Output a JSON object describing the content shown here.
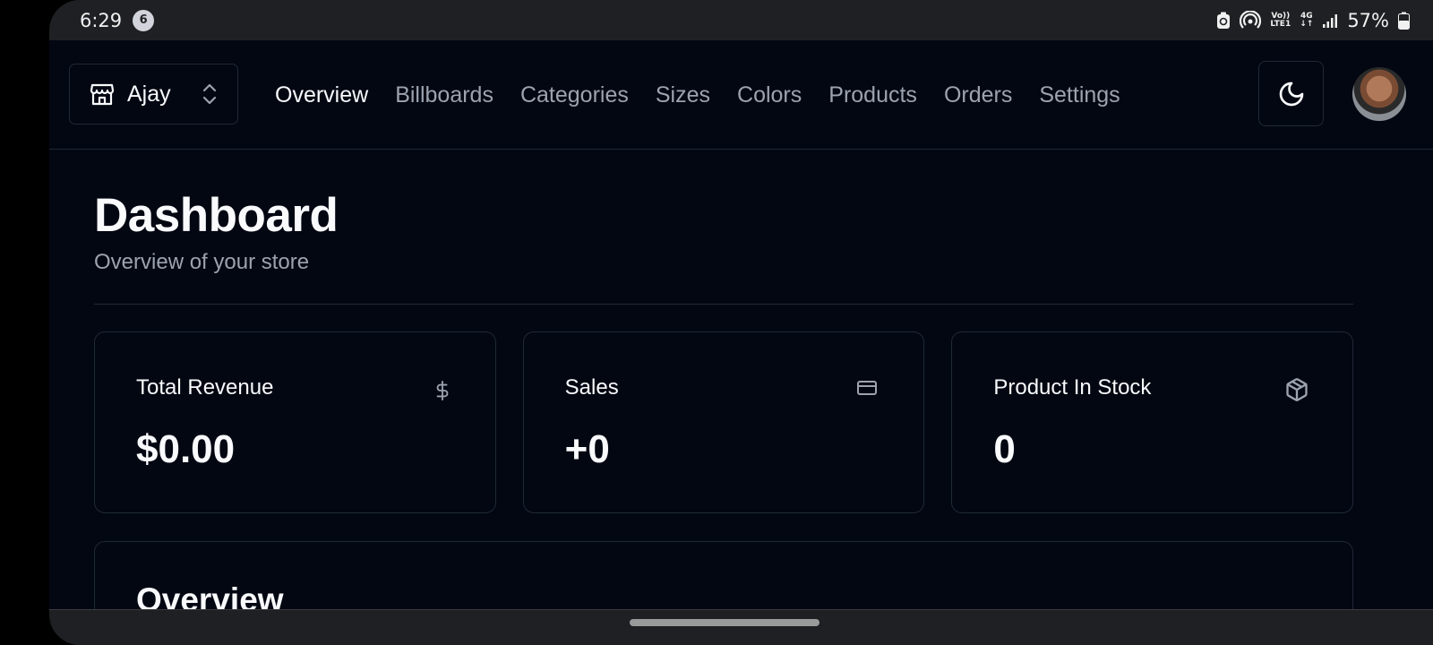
{
  "status_bar": {
    "time": "6:29",
    "notification_count": "6",
    "network_top": "Vo))",
    "network_bottom": "LTE1",
    "network_type": "4G",
    "battery": "57%"
  },
  "header": {
    "store_name": "Ajay",
    "nav": [
      "Overview",
      "Billboards",
      "Categories",
      "Sizes",
      "Colors",
      "Products",
      "Orders",
      "Settings"
    ],
    "active_nav": "Overview"
  },
  "page": {
    "title": "Dashboard",
    "subtitle": "Overview of your store"
  },
  "cards": [
    {
      "title": "Total Revenue",
      "value": "$0.00",
      "icon": "dollar-icon"
    },
    {
      "title": "Sales",
      "value": "+0",
      "icon": "credit-card-icon"
    },
    {
      "title": "Product In Stock",
      "value": "0",
      "icon": "package-icon"
    }
  ],
  "overview": {
    "title": "Overview"
  },
  "colors": {
    "background": "#030712",
    "border": "#1f2937",
    "muted_text": "#9ca3af",
    "text": "#f8fafc"
  }
}
